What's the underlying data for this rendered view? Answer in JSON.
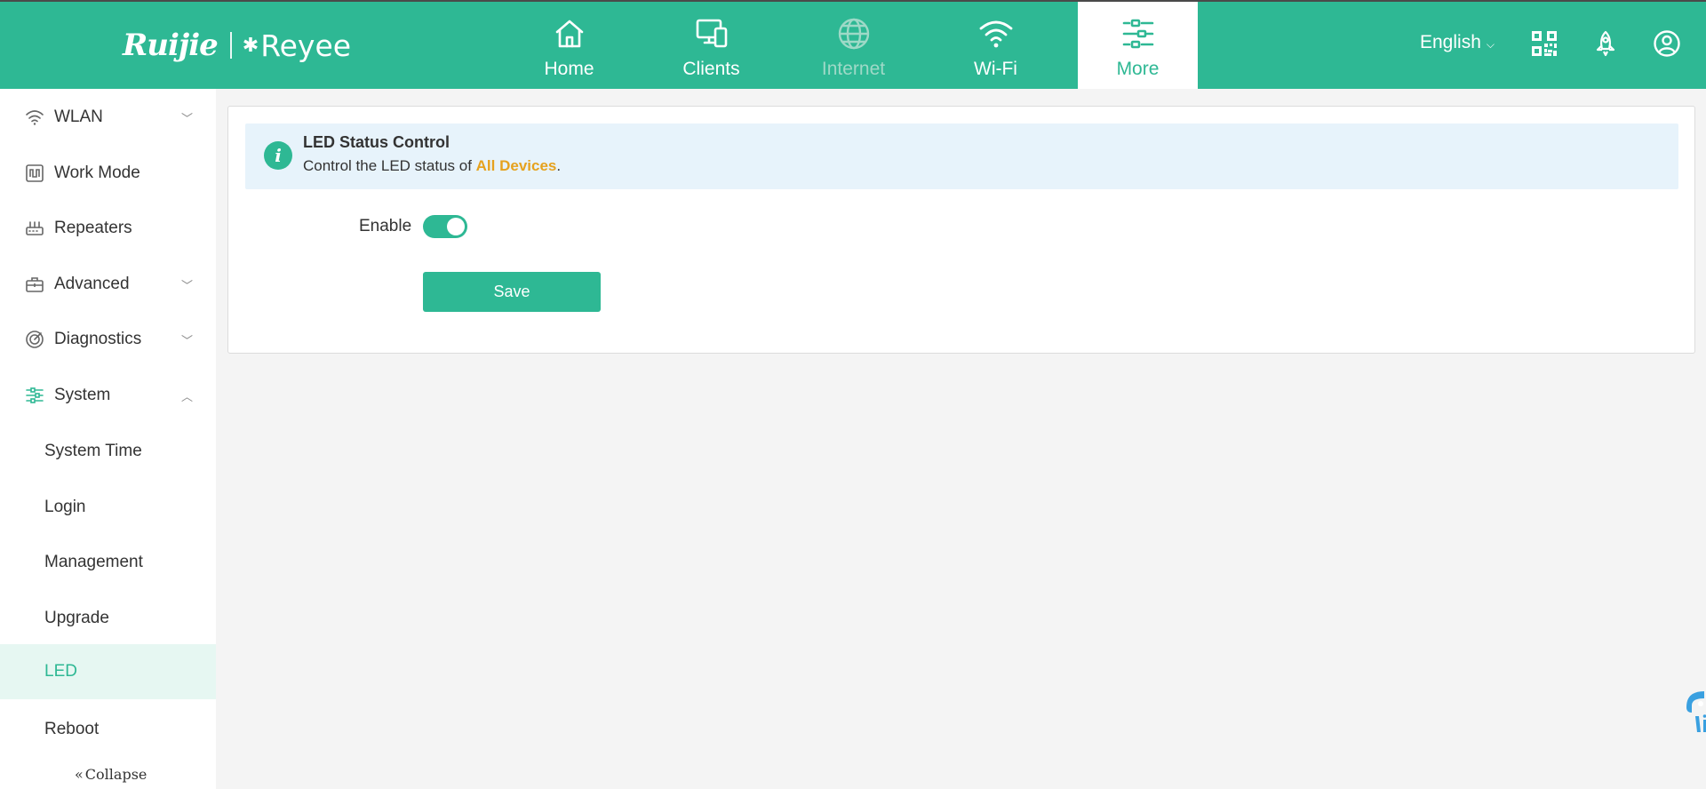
{
  "brand": {
    "primary": "Ruijie",
    "secondary": "Reyee"
  },
  "colors": {
    "accent": "#2eb894",
    "highlight": "#e6a21e",
    "banner_bg": "#e7f3fb"
  },
  "nav": {
    "items": [
      {
        "label": "Home",
        "icon": "home-icon",
        "state": "normal"
      },
      {
        "label": "Clients",
        "icon": "devices-icon",
        "state": "normal"
      },
      {
        "label": "Internet",
        "icon": "globe-icon",
        "state": "disabled"
      },
      {
        "label": "Wi-Fi",
        "icon": "wifi-icon",
        "state": "normal"
      },
      {
        "label": "More",
        "icon": "sliders-icon",
        "state": "active"
      }
    ]
  },
  "topbar": {
    "language": "English",
    "icons": [
      "qr-code-icon",
      "rocket-icon",
      "user-icon"
    ]
  },
  "sidebar": {
    "items": [
      {
        "label": "WLAN",
        "icon": "wifi-icon",
        "expandable": true,
        "expanded": false
      },
      {
        "label": "Work Mode",
        "icon": "work-mode-icon",
        "expandable": false
      },
      {
        "label": "Repeaters",
        "icon": "router-icon",
        "expandable": false
      },
      {
        "label": "Advanced",
        "icon": "toolbox-icon",
        "expandable": true,
        "expanded": false
      },
      {
        "label": "Diagnostics",
        "icon": "diagnostics-icon",
        "expandable": true,
        "expanded": false
      },
      {
        "label": "System",
        "icon": "sliders-icon",
        "expandable": true,
        "expanded": true
      }
    ],
    "subitems": [
      {
        "label": "System Time"
      },
      {
        "label": "Login"
      },
      {
        "label": "Management"
      },
      {
        "label": "Upgrade"
      },
      {
        "label": "LED",
        "active": true
      },
      {
        "label": "Reboot"
      }
    ],
    "collapse_label": "Collapse"
  },
  "main": {
    "banner": {
      "title": "LED Status Control",
      "desc_prefix": "Control the LED status of ",
      "desc_highlight": "All Devices",
      "desc_suffix": "."
    },
    "enable_label": "Enable",
    "enable_value": true,
    "save_label": "Save"
  }
}
